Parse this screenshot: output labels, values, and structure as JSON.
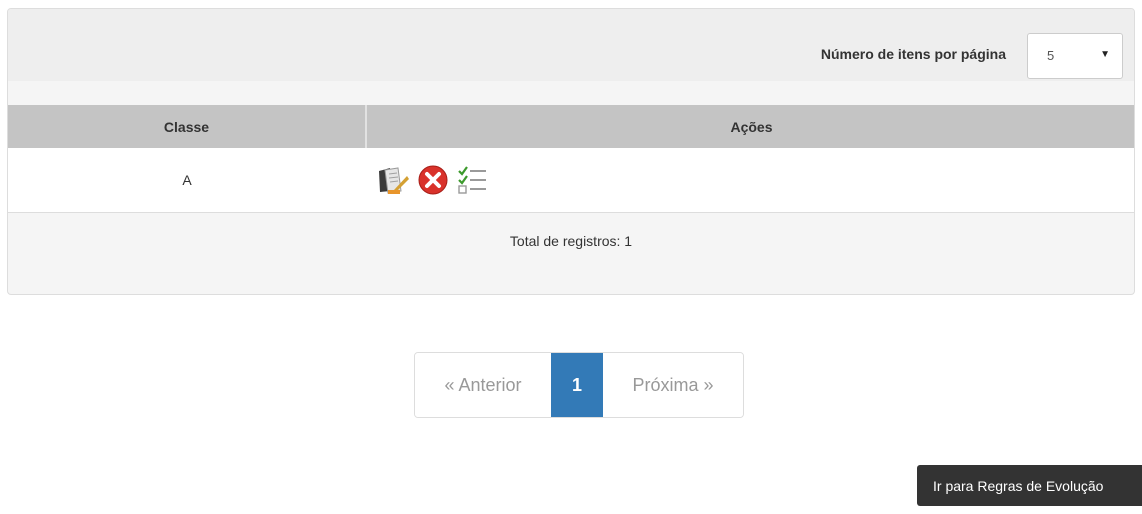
{
  "header": {
    "per_page_label": "Número de itens por página",
    "per_page_value": "5"
  },
  "table": {
    "columns": [
      "Classe",
      "Ações"
    ],
    "rows": [
      {
        "classe": "A",
        "actions": [
          "edit-icon",
          "delete-icon",
          "checklist-icon"
        ]
      }
    ]
  },
  "total_label": "Total de registros: 1",
  "pagination": {
    "prev_label": "« Anterior",
    "current_page": "1",
    "next_label": "Próxima »"
  },
  "goto_button_label": "Ir para Regras de Evolução",
  "colors": {
    "accent": "#337ab7",
    "delete_red": "#d9322b",
    "check_green": "#3c9a2c",
    "dark_button": "#333333"
  }
}
